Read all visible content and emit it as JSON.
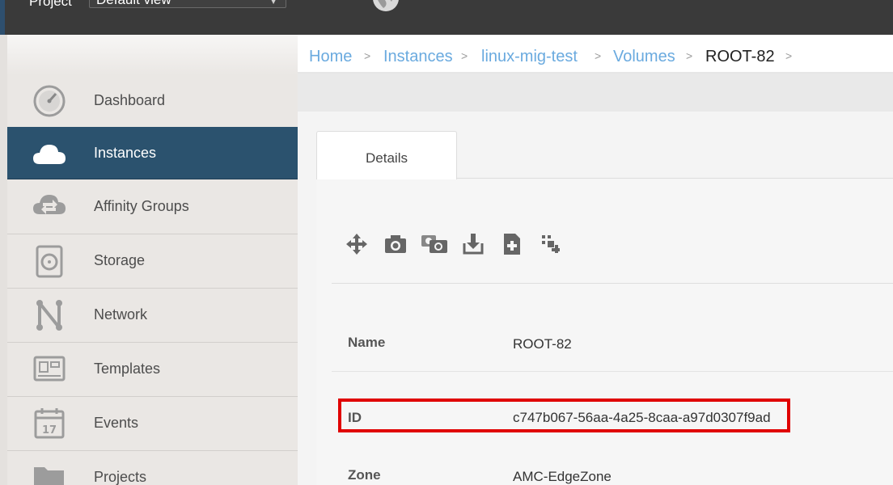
{
  "header": {
    "project_label": "Project",
    "project_select_value": "Default view"
  },
  "sidebar": {
    "items": [
      {
        "label": "Dashboard"
      },
      {
        "label": "Instances"
      },
      {
        "label": "Affinity Groups"
      },
      {
        "label": "Storage"
      },
      {
        "label": "Network"
      },
      {
        "label": "Templates"
      },
      {
        "label": "Events"
      },
      {
        "label": "Projects"
      }
    ],
    "active": "Instances"
  },
  "breadcrumb": {
    "items": [
      "Home",
      "Instances",
      "linux-mig-test",
      "Volumes",
      "ROOT-82"
    ],
    "separator": ">"
  },
  "tabs": {
    "details_label": "Details"
  },
  "details": {
    "name_label": "Name",
    "name_value": "ROOT-82",
    "id_label": "ID",
    "id_value": "c747b067-56aa-4a25-8caa-a97d0307f9ad",
    "zone_label": "Zone",
    "zone_value": "AMC-EdgeZone"
  },
  "icons": {
    "actions": [
      "move-icon",
      "camera-icon",
      "recurring-snapshot-icon",
      "download-icon",
      "add-document-icon",
      "resize-icon"
    ]
  },
  "colors": {
    "header_bg": "#3a3a3a",
    "sidebar_bg": "#eae7e4",
    "sidebar_active": "#2b526e",
    "link": "#6aaadf",
    "highlight": "#e00000"
  }
}
